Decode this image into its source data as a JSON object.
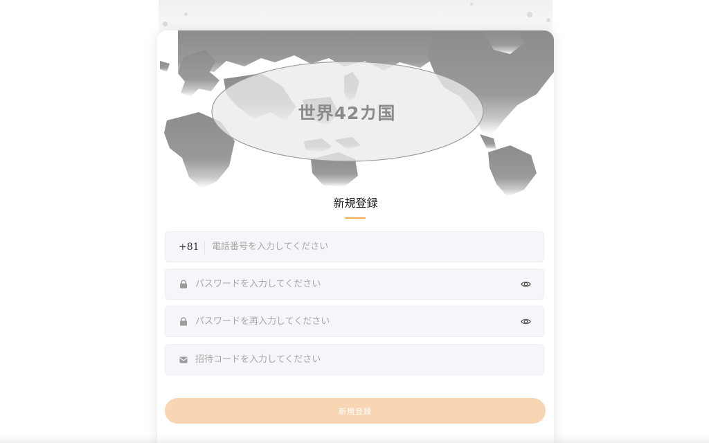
{
  "banner": {
    "text": "世界42カ国",
    "map_icon": "world-map-icon"
  },
  "form": {
    "title": "新規登録",
    "accent_color": "#f2a94f",
    "phone": {
      "country_code": "+81",
      "placeholder": "電話番号を入力してください"
    },
    "password": {
      "placeholder": "パスワードを入力してください",
      "lead_icon": "lock-icon",
      "trail_icon": "eye-icon"
    },
    "password_confirm": {
      "placeholder": "パスワードを再入力してください",
      "lead_icon": "lock-icon",
      "trail_icon": "eye-icon"
    },
    "invite_code": {
      "placeholder": "招待コードを入力してください",
      "lead_icon": "mail-icon"
    },
    "submit": {
      "label": "新規登録",
      "color": "#f8d5b3"
    }
  }
}
